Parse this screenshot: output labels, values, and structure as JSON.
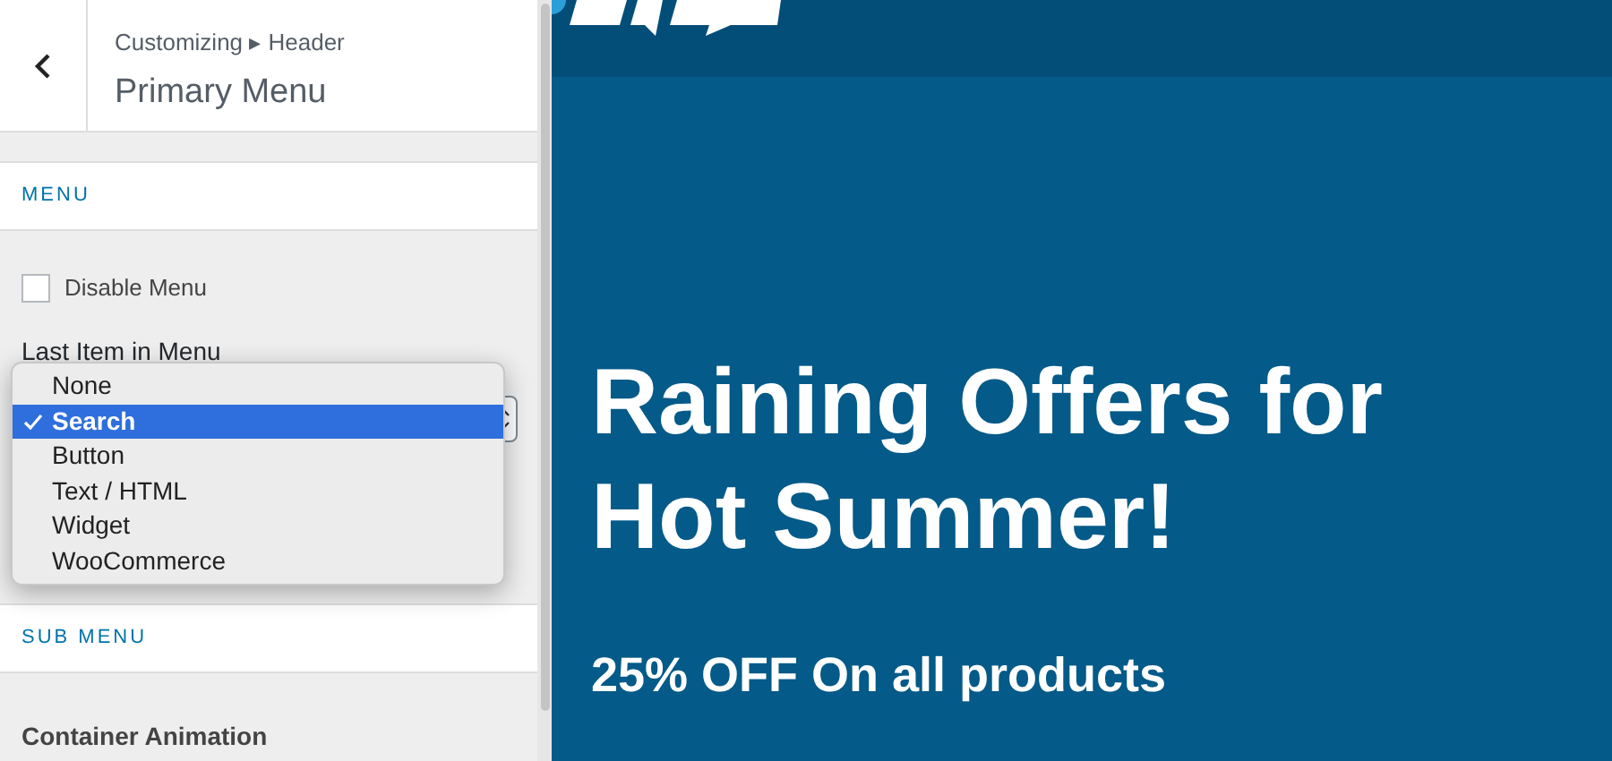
{
  "header": {
    "breadcrumb": "Customizing ▸ Header",
    "title": "Primary Menu"
  },
  "sections": [
    {
      "kind": "menu",
      "heading": "MENU",
      "checkbox": {
        "label": "Disable Menu",
        "checked": false
      },
      "select_label": "Last Item in Menu",
      "options": [
        {
          "label": "None",
          "selected": false
        },
        {
          "label": "Search",
          "selected": true
        },
        {
          "label": "Button",
          "selected": false
        },
        {
          "label": "Text / HTML",
          "selected": false
        },
        {
          "label": "Widget",
          "selected": false
        },
        {
          "label": "WooCommerce",
          "selected": false
        }
      ]
    },
    {
      "kind": "submenu",
      "heading": "SUB MENU",
      "field_label": "Container Animation"
    }
  ],
  "preview": {
    "headline": [
      "Raining Offers for",
      "Hot Summer!"
    ],
    "subline": "25% OFF On all products"
  }
}
